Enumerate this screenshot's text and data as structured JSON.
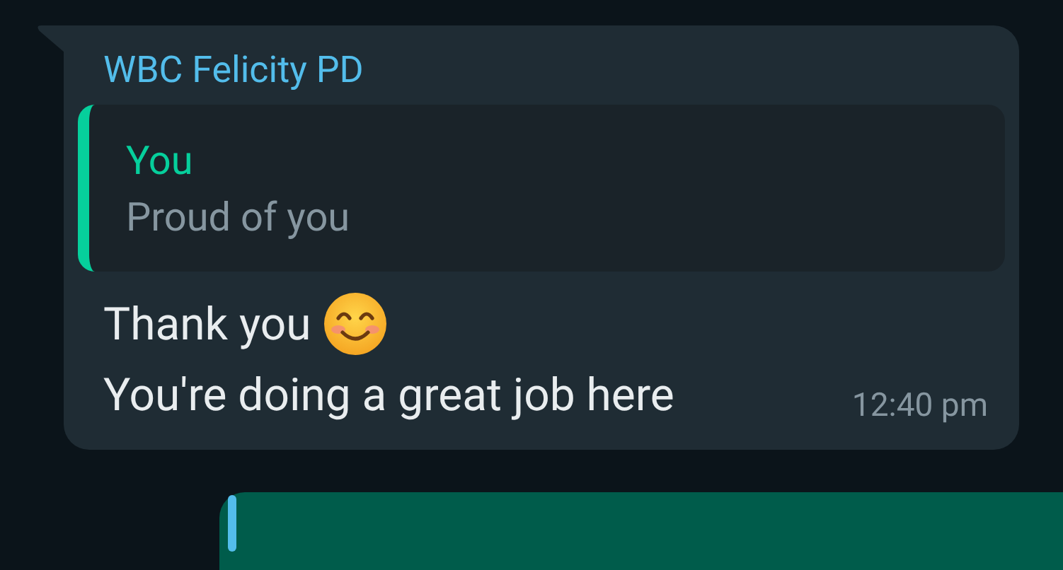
{
  "incoming_message": {
    "sender": "WBC Felicity PD",
    "quoted": {
      "author": "You",
      "text": "Proud of you"
    },
    "lines": [
      "Thank you",
      "You're doing a great job here"
    ],
    "time": "12:40 pm"
  },
  "outgoing_message": {
    "visible": true
  }
}
